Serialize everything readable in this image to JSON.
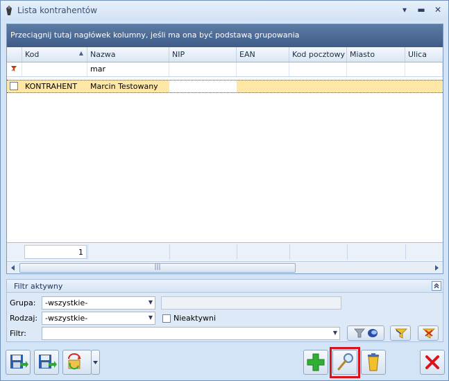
{
  "window": {
    "title": "Lista kontrahentów",
    "controls": [
      "▾",
      "▬",
      "✕"
    ]
  },
  "grid": {
    "group_panel_text": "Przeciągnij tutaj nagłówek kolumny, jeśli ma ona być podstawą grupowania",
    "columns": [
      "Kod",
      "Nazwa",
      "NIP",
      "EAN",
      "Kod pocztowy",
      "Miasto",
      "Ulica"
    ],
    "sort_indicator": "▲",
    "filter_row": {
      "nazwa": "mar"
    },
    "rows": [
      {
        "kod": "KONTRAHENT",
        "nazwa": "Marcin Testowany"
      }
    ],
    "footer_count": "1",
    "scroll_grip": "|||"
  },
  "filter_panel": {
    "title": "Filtr aktywny",
    "grupa_label": "Grupa:",
    "grupa_value": "-wszystkie-",
    "rodzaj_label": "Rodzaj:",
    "rodzaj_value": "-wszystkie-",
    "nieaktywni_label": "Nieaktywni",
    "filtr_label": "Filtr:",
    "filtr_value": ""
  },
  "colors": {
    "row_selected": "#ffe8a6",
    "highlight_box": "#d8131c",
    "accent": "#3e5c87"
  }
}
